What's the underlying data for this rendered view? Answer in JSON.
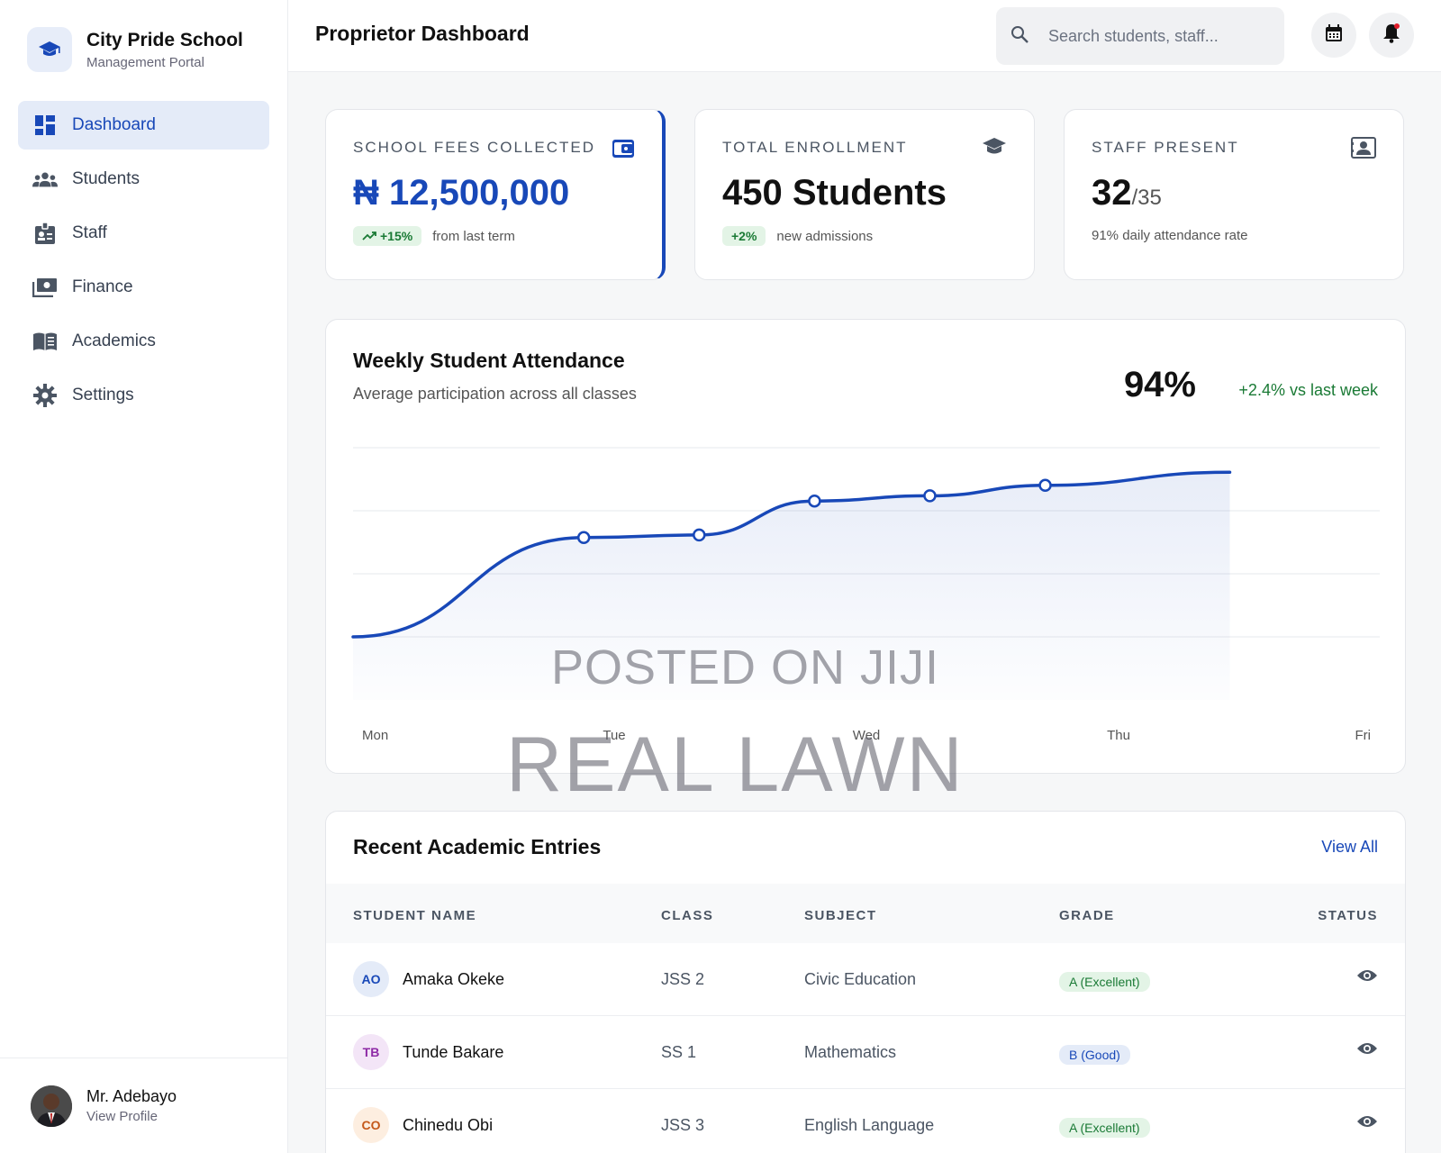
{
  "brand": {
    "title": "City Pride School",
    "subtitle": "Management Portal",
    "logo_icon": "graduation-cap-icon"
  },
  "nav": [
    {
      "label": "Dashboard",
      "icon": "dashboard-icon",
      "active": true
    },
    {
      "label": "Students",
      "icon": "people-icon",
      "active": false
    },
    {
      "label": "Staff",
      "icon": "id-badge-icon",
      "active": false
    },
    {
      "label": "Finance",
      "icon": "money-icon",
      "active": false
    },
    {
      "label": "Academics",
      "icon": "book-icon",
      "active": false
    },
    {
      "label": "Settings",
      "icon": "gear-icon",
      "active": false
    }
  ],
  "profile": {
    "name": "Mr. Adebayo",
    "link": "View Profile"
  },
  "header": {
    "title": "Proprietor Dashboard",
    "search_placeholder": "Search students, staff..."
  },
  "stats": {
    "fees": {
      "label": "SCHOOL FEES COLLECTED",
      "value": "₦ 12,500,000",
      "change": "+15%",
      "note": "from last term",
      "icon": "wallet-icon"
    },
    "enrollment": {
      "label": "TOTAL ENROLLMENT",
      "value": "450 Students",
      "change": "+2%",
      "note": "new admissions",
      "icon": "graduation-cap-icon"
    },
    "staff": {
      "label": "STAFF PRESENT",
      "value": "32",
      "total": "/35",
      "note": "91% daily attendance rate",
      "icon": "contact-card-icon"
    }
  },
  "attendance": {
    "title": "Weekly Student Attendance",
    "subtitle": "Average participation across all classes",
    "big_value": "94%",
    "delta": "+2.4% vs last week"
  },
  "chart_data": {
    "type": "area",
    "categories": [
      "Mon",
      "Tue",
      "Wed",
      "Thu",
      "Fri"
    ],
    "values": [
      20,
      58,
      59,
      72,
      74,
      78,
      83
    ],
    "x": [
      0,
      1,
      1.5,
      2,
      2.5,
      3,
      3.8
    ],
    "markers": [
      1,
      1.5,
      2,
      2.5,
      3
    ],
    "ylim": [
      0,
      100
    ],
    "grid": true,
    "accent": "#1848b8"
  },
  "recent": {
    "title": "Recent Academic Entries",
    "view_all": "View All",
    "columns": [
      "STUDENT NAME",
      "CLASS",
      "SUBJECT",
      "GRADE",
      "STATUS"
    ],
    "rows": [
      {
        "initials": "AO",
        "name": "Amaka Okeke",
        "class": "JSS 2",
        "subject": "Civic Education",
        "grade": "A (Excellent)",
        "grade_color": "green",
        "avatar_bg": "#e4ebf8",
        "avatar_fg": "#1848b8"
      },
      {
        "initials": "TB",
        "name": "Tunde Bakare",
        "class": "SS 1",
        "subject": "Mathematics",
        "grade": "B (Good)",
        "grade_color": "blue",
        "avatar_bg": "#f3e5f7",
        "avatar_fg": "#8e2aa6"
      },
      {
        "initials": "CO",
        "name": "Chinedu Obi",
        "class": "JSS 3",
        "subject": "English Language",
        "grade": "A (Excellent)",
        "grade_color": "green",
        "avatar_bg": "#fdeee0",
        "avatar_fg": "#c4581a"
      }
    ]
  },
  "watermark": {
    "line1": "POSTED ON JIJI",
    "line2": "REAL LAWN"
  }
}
